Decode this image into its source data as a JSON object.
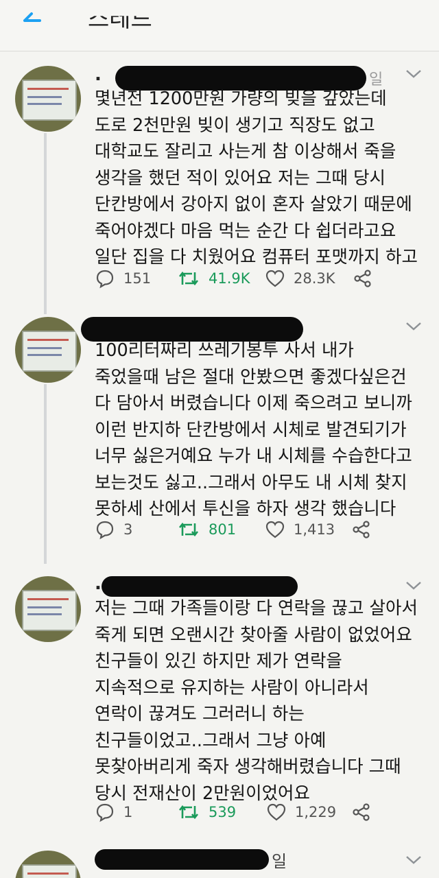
{
  "header": {
    "title": "스레드"
  },
  "tweets": [
    {
      "dot": ".",
      "handle_fragment": "일",
      "body": "몇년전 1200만원 가량의 빚을 갚았는데\n도로 2천만원 빚이 생기고 직장도 없고\n대학교도 잘리고 사는게 참 이상해서 죽을\n생각을 했던 적이 있어요 저는 그때 당시\n단칸방에서 강아지 없이 혼자 살았기 때문에\n죽어야겠다 마음 먹는 순간 다 쉽더라고요\n일단 집을 다 치웠어요 컴퓨터 포맷까지 하고",
      "replies": "151",
      "retweets": "41.9K",
      "likes": "28.3K"
    },
    {
      "dot": "",
      "handle_fragment": "",
      "body": "100리터짜리 쓰레기봉투 사서 내가\n죽었을때 남은 절대 안봤으면 좋겠다싶은건\n다 담아서 버렸습니다 이제 죽으려고 보니까\n이런 반지하 단칸방에서 시체로 발견되기가\n너무 싫은거예요 누가 내 시체를 수습한다고\n보는것도 싫고..그래서 아무도 내 시체 찾지\n못하세 산에서 투신을 하자 생각 했습니다",
      "replies": "3",
      "retweets": "801",
      "likes": "1,413"
    },
    {
      "dot": ".",
      "handle_fragment": "",
      "body": "저는 그때 가족들이랑 다 연락을 끊고 살아서\n죽게 되면 오랜시간 찾아줄 사람이 없었어요\n친구들이 있긴 하지만 제가 연락을\n지속적으로 유지하는 사람이 아니라서\n연락이 끊겨도 그러러니 하는\n친구들이었고..그래서 그냥 아예\n못찾아버리게 죽자 생각해버렸습니다 그때\n당시 전재산이 2만원이었어요",
      "replies": "1",
      "retweets": "539",
      "likes": "1,229"
    },
    {
      "dot": "",
      "handle_fragment": "일",
      "body": "",
      "replies": "",
      "retweets": "",
      "likes": ""
    }
  ],
  "icons": {
    "back": "arrow-left-icon",
    "reply": "reply-icon",
    "retweet": "retweet-icon",
    "like": "heart-icon",
    "share": "share-icon",
    "more": "chevron-down-icon"
  },
  "colors": {
    "accent": "#1da1f2",
    "retweet": "#1a9a5a",
    "background": "#f4f4f1"
  }
}
